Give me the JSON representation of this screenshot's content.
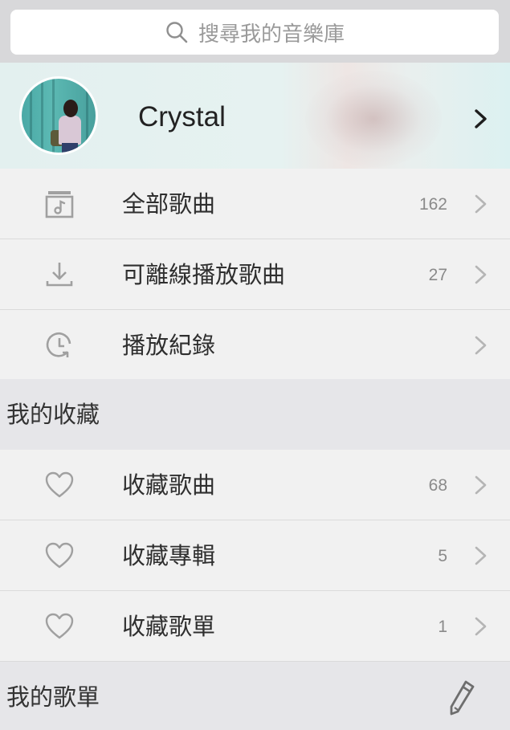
{
  "search": {
    "placeholder": "搜尋我的音樂庫",
    "icon": "search-icon"
  },
  "profile": {
    "name": "Crystal"
  },
  "library": [
    {
      "label": "全部歌曲",
      "count": "162",
      "icon": "music-file-icon"
    },
    {
      "label": "可離線播放歌曲",
      "count": "27",
      "icon": "download-icon"
    },
    {
      "label": "播放紀錄",
      "count": "",
      "icon": "history-icon"
    }
  ],
  "favorites": {
    "title": "我的收藏",
    "items": [
      {
        "label": "收藏歌曲",
        "count": "68",
        "icon": "heart-icon"
      },
      {
        "label": "收藏專輯",
        "count": "5",
        "icon": "heart-icon"
      },
      {
        "label": "收藏歌單",
        "count": "1",
        "icon": "heart-icon"
      }
    ]
  },
  "playlists": {
    "title": "我的歌單",
    "edit_icon": "pencil-icon"
  },
  "colors": {
    "background": "#f1f1f1",
    "section": "#e6e6e9",
    "text": "#2f2f2f",
    "muted": "#8a8a8a"
  }
}
